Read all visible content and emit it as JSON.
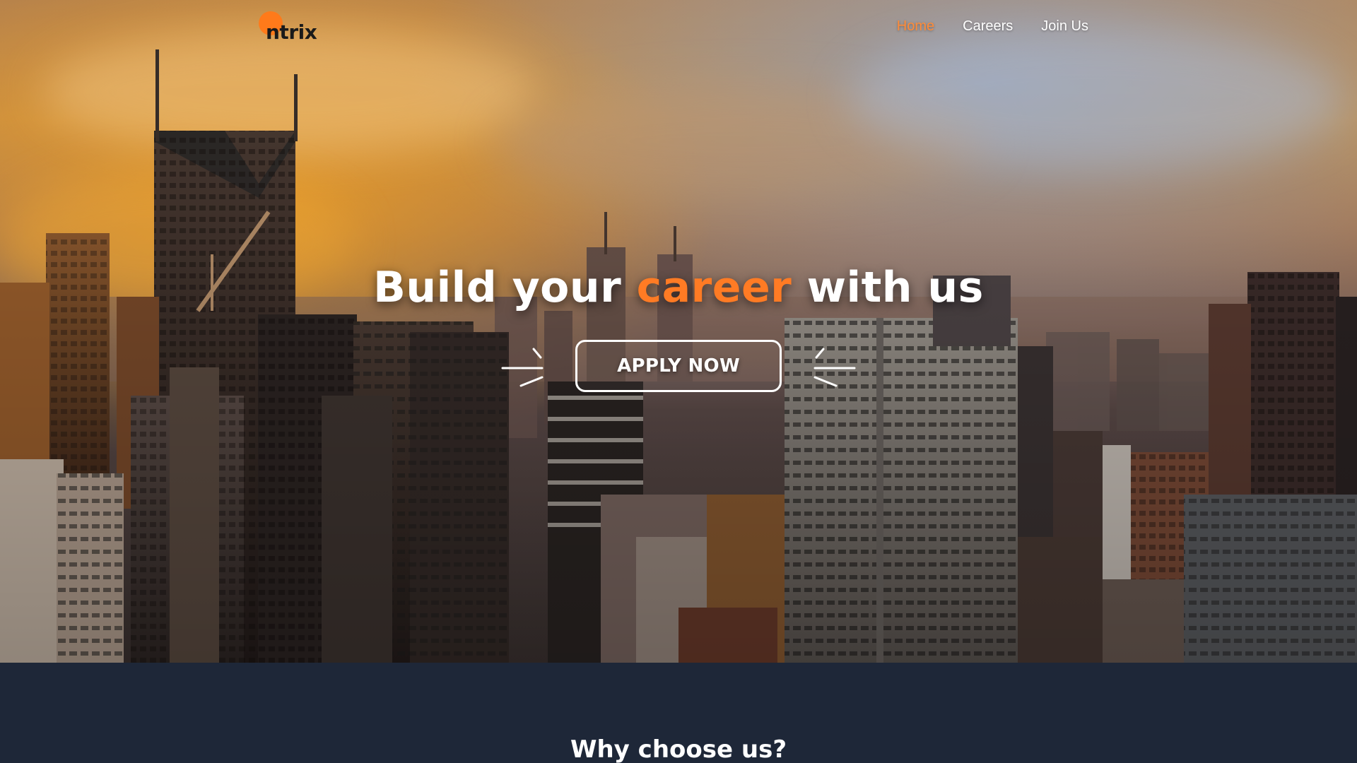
{
  "brand": {
    "logo_text": "ntrix",
    "accent_color": "#ff7a1a"
  },
  "nav": {
    "items": [
      {
        "label": "Home",
        "active": true
      },
      {
        "label": "Careers",
        "active": false
      },
      {
        "label": "Join Us",
        "active": false
      }
    ]
  },
  "hero": {
    "headline_before": "Build your ",
    "headline_accent": "career",
    "headline_after": " with us",
    "cta_label": "APPLY NOW",
    "background_image": "city-skyline-sunset"
  },
  "section": {
    "title": "Why choose us?",
    "background_color": "#1e2738"
  }
}
